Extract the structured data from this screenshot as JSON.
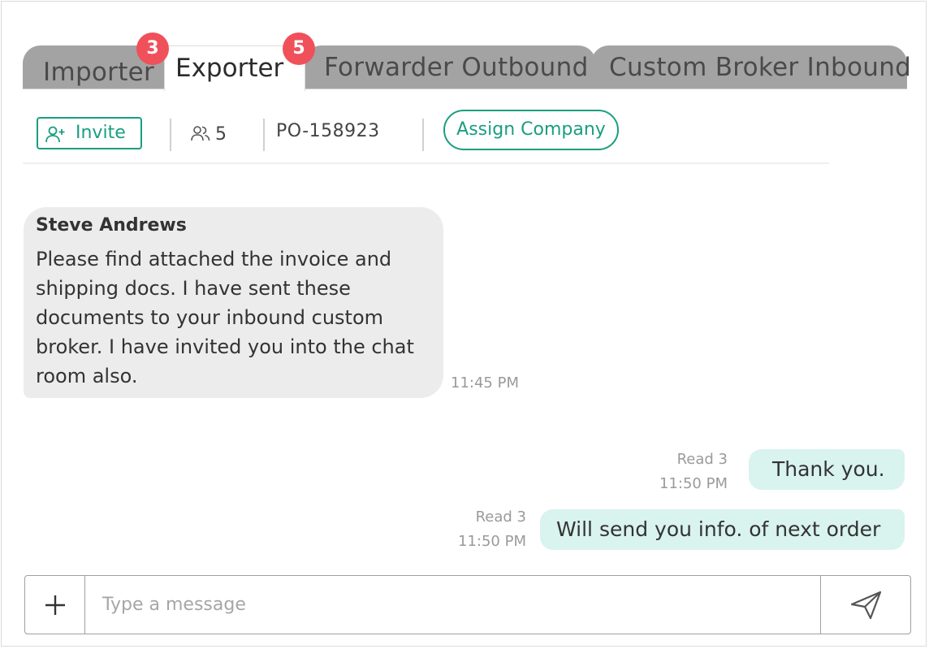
{
  "tabs": [
    {
      "label": "Importer",
      "badge": "3",
      "active": false
    },
    {
      "label": "Exporter",
      "badge": "5",
      "active": true
    },
    {
      "label": "Forwarder Outbound",
      "active": false
    },
    {
      "label": "Custom Broker Inbound",
      "active": false
    }
  ],
  "toolbar": {
    "invite_label": "Invite",
    "member_count": "5",
    "po_number": "PO-158923",
    "assign_label": "Assign Company"
  },
  "messages": [
    {
      "direction": "incoming",
      "sender": "Steve Andrews",
      "text": "Please find attached the invoice and shipping docs. I have sent these documents to your inbound custom broker. I have invited you into the chat room also.",
      "time": "11:45 PM"
    },
    {
      "direction": "outgoing",
      "text": "Thank you.",
      "read": "Read 3",
      "time": "11:50 PM"
    },
    {
      "direction": "outgoing",
      "text": "Will send you info. of next order",
      "read": "Read 3",
      "time": "11:50 PM"
    }
  ],
  "composer": {
    "placeholder": "Type a message",
    "value": ""
  },
  "colors": {
    "accent": "#1a9e80",
    "badge": "#f0505a",
    "inactive_tab": "#a3a3a3",
    "incoming_bubble": "#ececec",
    "outgoing_bubble": "#d9f3ee"
  },
  "icons": {
    "invite": "add-user-icon",
    "members": "users-icon",
    "attach": "plus-icon",
    "send": "send-icon"
  }
}
